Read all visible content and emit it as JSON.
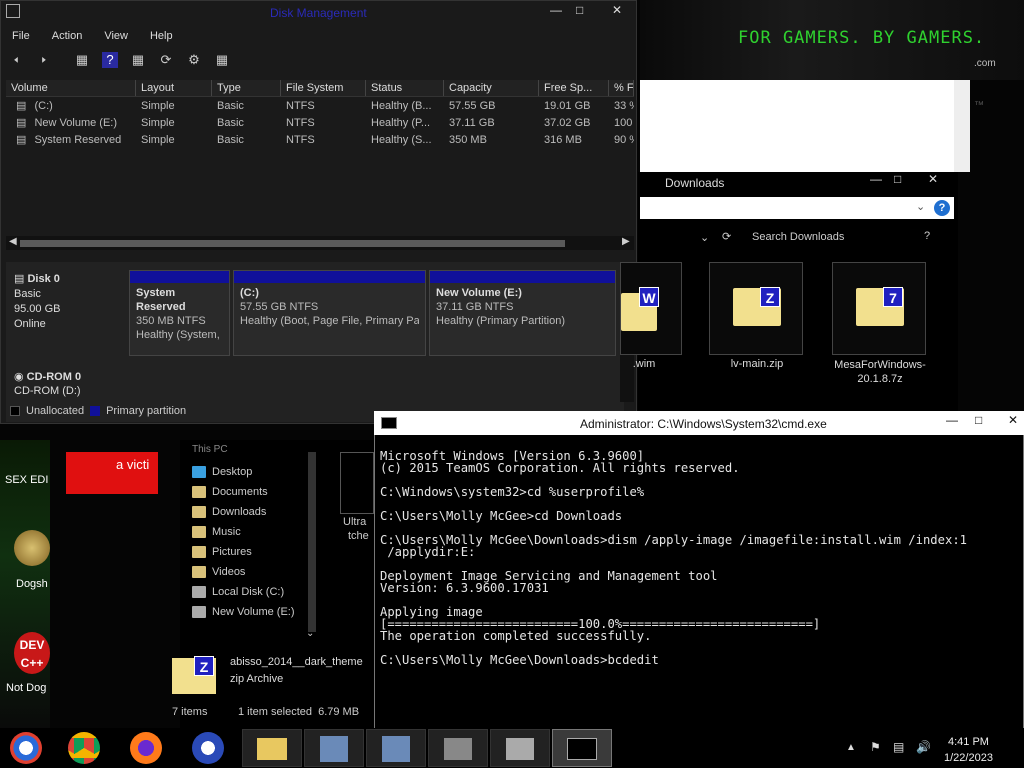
{
  "banner": {
    "slogan": "FOR GAMERS. BY GAMERS.",
    "tm": "™",
    "suffix": ".com"
  },
  "disk_management": {
    "title": "Disk Management",
    "menu": [
      "File",
      "Action",
      "View",
      "Help"
    ],
    "columns": [
      "Volume",
      "Layout",
      "Type",
      "File System",
      "Status",
      "Capacity",
      "Free Sp...",
      "% Fr"
    ],
    "rows": [
      [
        "(C:)",
        "Simple",
        "Basic",
        "NTFS",
        "Healthy (B...",
        "57.55 GB",
        "19.01 GB",
        "33 %"
      ],
      [
        "New Volume (E:)",
        "Simple",
        "Basic",
        "NTFS",
        "Healthy (P...",
        "37.11 GB",
        "37.02 GB",
        "100 %"
      ],
      [
        "System Reserved",
        "Simple",
        "Basic",
        "NTFS",
        "Healthy (S...",
        "350 MB",
        "316 MB",
        "90 %"
      ]
    ],
    "disk0": {
      "name": "Disk 0",
      "type": "Basic",
      "size": "95.00 GB",
      "state": "Online"
    },
    "partitions": [
      {
        "name": "System Reserved",
        "size": "350 MB NTFS",
        "status": "Healthy (System,"
      },
      {
        "name": "(C:)",
        "size": "57.55 GB NTFS",
        "status": "Healthy (Boot, Page File, Primary Pa"
      },
      {
        "name": "New Volume  (E:)",
        "size": "37.11 GB NTFS",
        "status": "Healthy (Primary Partition)"
      }
    ],
    "cdrom": {
      "name": "CD-ROM 0",
      "label": "CD-ROM (D:)"
    },
    "legend": [
      "Unallocated",
      "Primary partition"
    ],
    "colors": {
      "primary_partition": "#10109a",
      "title": "#2a2ab8"
    }
  },
  "downloads": {
    "title": "Downloads",
    "search_placeholder": "Search Downloads",
    "help": "?",
    "files": [
      {
        "name": ".wim",
        "badge": "W"
      },
      {
        "name": "lv-main.zip",
        "badge": "Z"
      },
      {
        "name": "MesaForWindows-20.1.8.7z",
        "badge": "7"
      }
    ]
  },
  "cmd": {
    "title": "Administrator: C:\\Windows\\System32\\cmd.exe",
    "lines": [
      "Microsoft Windows [Version 6.3.9600]",
      "(c) 2015 TeamOS Corporation. All rights reserved.",
      "",
      "C:\\Windows\\system32>cd %userprofile%",
      "",
      "C:\\Users\\Molly McGee>cd Downloads",
      "",
      "C:\\Users\\Molly McGee\\Downloads>dism /apply-image /imagefile:install.wim /index:1",
      " /applydir:E:",
      "",
      "Deployment Image Servicing and Management tool",
      "Version: 6.3.9600.17031",
      "",
      "Applying image",
      "[==========================100.0%==========================]",
      "The operation completed successfully.",
      "",
      "C:\\Users\\Molly McGee\\Downloads>bcdedit"
    ]
  },
  "explorer": {
    "nav": [
      "This PC",
      "Desktop",
      "Documents",
      "Downloads",
      "Music",
      "Pictures",
      "Videos",
      "Local Disk (C:)",
      "New Volume (E:)"
    ],
    "selected_file": {
      "name": "abisso_2014__dark_theme",
      "type": "zip Archive"
    },
    "status_items": "7 items",
    "status_selected": "1 item selected  6.79 MB",
    "partial_file": [
      "Ultra",
      "tche"
    ]
  },
  "desktop": {
    "icons": [
      "SEX EDI",
      "Dogsh",
      "Not Dog"
    ],
    "red_text": "a victi"
  },
  "clock": {
    "time": "4:41 PM",
    "date": "1/22/2023"
  }
}
